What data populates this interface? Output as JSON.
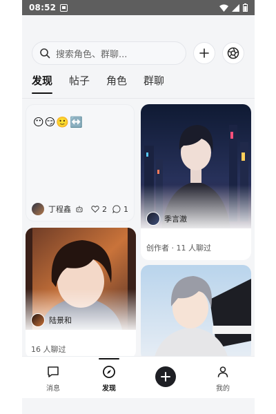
{
  "status_bar": {
    "time": "08:52"
  },
  "search": {
    "placeholder": "搜索角色、群聊..."
  },
  "tabs": [
    {
      "label": "发现",
      "active": true
    },
    {
      "label": "帖子",
      "active": false
    },
    {
      "label": "角色",
      "active": false
    },
    {
      "label": "群聊",
      "active": false
    }
  ],
  "cards": {
    "post": {
      "content": "😶😏🙂↔️",
      "author": "丁程鑫",
      "likes": "2",
      "comments": "1"
    },
    "character1": {
      "name": "季言澈",
      "meta": "创作者 · 11 人聊过"
    },
    "character2": {
      "name": "陆景和",
      "meta": "16 人聊过"
    },
    "character3": {
      "name": ""
    }
  },
  "bottom_nav": [
    {
      "label": "消息",
      "icon": "chat-icon",
      "active": false
    },
    {
      "label": "发现",
      "icon": "compass-icon",
      "active": true
    },
    {
      "label": "",
      "icon": "plus-icon",
      "active": false
    },
    {
      "label": "我的",
      "icon": "person-icon",
      "active": false
    }
  ],
  "colors": {
    "accent": "#111111",
    "background": "#f4f5f7",
    "fab": "#1e1f24"
  }
}
